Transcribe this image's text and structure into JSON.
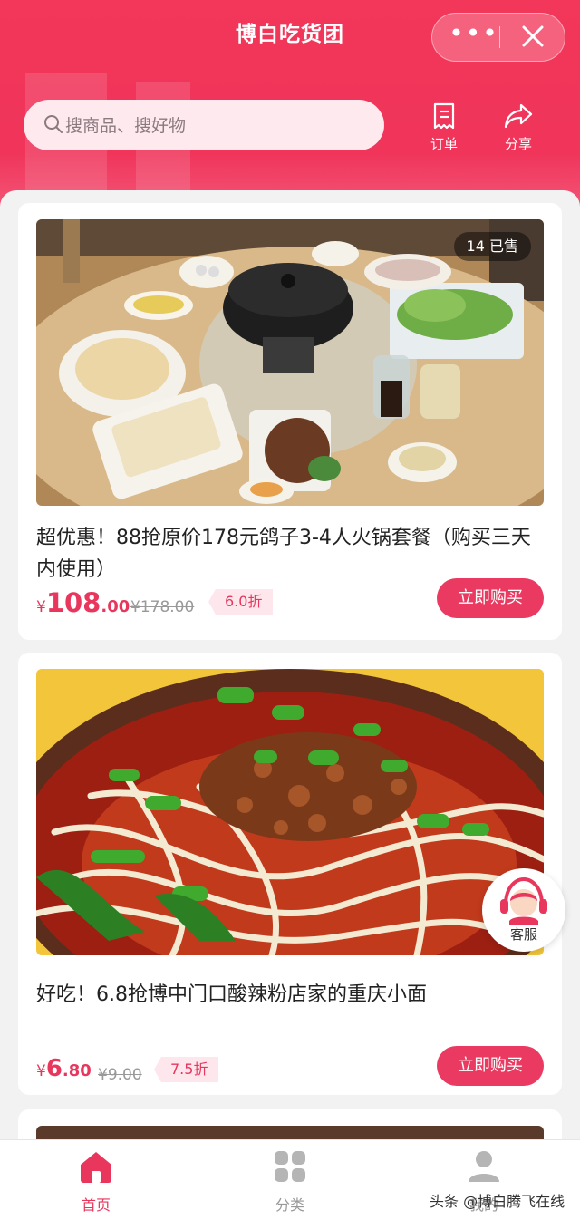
{
  "header": {
    "title": "博白吃货团",
    "more_icon": "more-dots-icon",
    "close_icon": "close-icon",
    "search_placeholder": "搜商品、搜好物",
    "orders_label": "订单",
    "share_label": "分享",
    "accent": "#f0345a"
  },
  "products": [
    {
      "sold": "14 已售",
      "name": "超优惠！88抢原价178元鸽子3-4人火锅套餐（购买三天内使用）",
      "price_symbol": "¥",
      "price_int": "108",
      "price_dec": ".00",
      "orig_price": "¥178.00",
      "discount": "6.0折",
      "buy_label": "立即购买"
    },
    {
      "name": "好吃！6.8抢博中门口酸辣粉店家的重庆小面",
      "price_symbol": "¥",
      "price_int": "6",
      "price_dec": ".80",
      "orig_price": "¥9.00",
      "discount": "7.5折",
      "buy_label": "立即购买"
    }
  ],
  "service_label": "客服",
  "tabbar": {
    "home": "首页",
    "category": "分类",
    "mine": "我的"
  },
  "watermark": "头条 @博白腾飞在线"
}
